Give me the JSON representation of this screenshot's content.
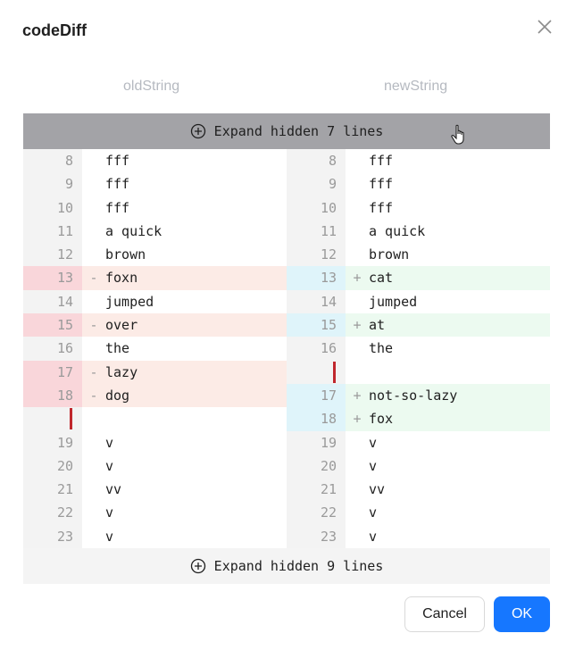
{
  "dialog": {
    "title": "codeDiff",
    "close_icon": "close-icon",
    "cancel_label": "Cancel",
    "ok_label": "OK",
    "accent_color": "#1677ff"
  },
  "columns": {
    "old_label": "oldString",
    "new_label": "newString"
  },
  "expand": {
    "top_label": "Expand hidden 7 lines",
    "bottom_label": "Expand hidden 9 lines",
    "icon": "plus-circle-icon"
  },
  "rows": [
    {
      "left": {
        "num": "8",
        "mark": "",
        "text": "fff",
        "type": "normal"
      },
      "right": {
        "num": "8",
        "mark": "",
        "text": "fff",
        "type": "normal"
      }
    },
    {
      "left": {
        "num": "9",
        "mark": "",
        "text": "fff",
        "type": "normal"
      },
      "right": {
        "num": "9",
        "mark": "",
        "text": "fff",
        "type": "normal"
      }
    },
    {
      "left": {
        "num": "10",
        "mark": "",
        "text": "fff",
        "type": "normal"
      },
      "right": {
        "num": "10",
        "mark": "",
        "text": "fff",
        "type": "normal"
      }
    },
    {
      "left": {
        "num": "11",
        "mark": "",
        "text": "a quick",
        "type": "normal"
      },
      "right": {
        "num": "11",
        "mark": "",
        "text": "a quick",
        "type": "normal"
      }
    },
    {
      "left": {
        "num": "12",
        "mark": "",
        "text": "brown",
        "type": "normal"
      },
      "right": {
        "num": "12",
        "mark": "",
        "text": "brown",
        "type": "normal"
      }
    },
    {
      "left": {
        "num": "13",
        "mark": "-",
        "text": "foxn",
        "type": "del"
      },
      "right": {
        "num": "13",
        "mark": "+",
        "text": "cat",
        "type": "add"
      }
    },
    {
      "left": {
        "num": "14",
        "mark": "",
        "text": "jumped",
        "type": "normal"
      },
      "right": {
        "num": "14",
        "mark": "",
        "text": "jumped",
        "type": "normal"
      }
    },
    {
      "left": {
        "num": "15",
        "mark": "-",
        "text": "over",
        "type": "del"
      },
      "right": {
        "num": "15",
        "mark": "+",
        "text": "at",
        "type": "add"
      }
    },
    {
      "left": {
        "num": "16",
        "mark": "",
        "text": "the",
        "type": "normal"
      },
      "right": {
        "num": "16",
        "mark": "",
        "text": "the",
        "type": "normal"
      }
    },
    {
      "left": {
        "num": "17",
        "mark": "-",
        "text": "lazy",
        "type": "del"
      },
      "right": {
        "num": "",
        "mark": "",
        "text": "",
        "type": "empty-bar"
      }
    },
    {
      "left": {
        "num": "18",
        "mark": "-",
        "text": "dog",
        "type": "del"
      },
      "right": {
        "num": "17",
        "mark": "+",
        "text": "not-so-lazy",
        "type": "add"
      }
    },
    {
      "left": {
        "num": "",
        "mark": "",
        "text": "",
        "type": "empty-bar"
      },
      "right": {
        "num": "18",
        "mark": "+",
        "text": "fox",
        "type": "add"
      }
    },
    {
      "left": {
        "num": "19",
        "mark": "",
        "text": "v",
        "type": "normal"
      },
      "right": {
        "num": "19",
        "mark": "",
        "text": "v",
        "type": "normal"
      }
    },
    {
      "left": {
        "num": "20",
        "mark": "",
        "text": "v",
        "type": "normal"
      },
      "right": {
        "num": "20",
        "mark": "",
        "text": "v",
        "type": "normal"
      }
    },
    {
      "left": {
        "num": "21",
        "mark": "",
        "text": "vv",
        "type": "normal"
      },
      "right": {
        "num": "21",
        "mark": "",
        "text": "vv",
        "type": "normal"
      }
    },
    {
      "left": {
        "num": "22",
        "mark": "",
        "text": "v",
        "type": "normal"
      },
      "right": {
        "num": "22",
        "mark": "",
        "text": "v",
        "type": "normal"
      }
    },
    {
      "left": {
        "num": "23",
        "mark": "",
        "text": "v",
        "type": "normal"
      },
      "right": {
        "num": "23",
        "mark": "",
        "text": "v",
        "type": "normal"
      }
    }
  ]
}
